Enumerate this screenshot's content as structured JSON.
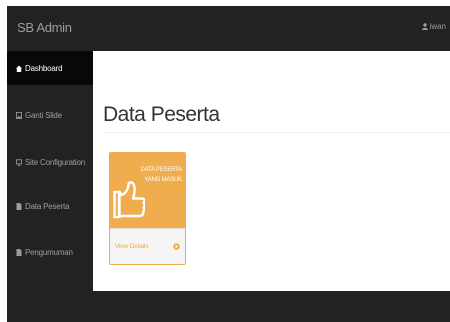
{
  "app": {
    "brand": "SB Admin",
    "user": "iwan"
  },
  "sidebar": {
    "items": [
      {
        "label": "Dashboard",
        "icon": "dashboard-icon",
        "active": true
      },
      {
        "label": "Ganti Slide",
        "icon": "image-icon",
        "active": false
      },
      {
        "label": "Site Configuration",
        "icon": "desktop-icon",
        "active": false
      },
      {
        "label": "Data Peserta",
        "icon": "file-icon",
        "active": false
      },
      {
        "label": "Pengumuman",
        "icon": "file-icon",
        "active": false
      }
    ]
  },
  "main": {
    "title": "Data Peserta",
    "panel": {
      "line1": "DATA PESERTA",
      "line2": "YANG MASUK",
      "footer_label": "View Details",
      "icon": "thumbs-up-icon",
      "footer_icon": "arrow-circle-right-icon"
    }
  },
  "colors": {
    "navbar": "#222222",
    "sidebar_active": "#080808",
    "nav_text": "#9d9d9d",
    "panel_accent": "#f0ad4e"
  }
}
